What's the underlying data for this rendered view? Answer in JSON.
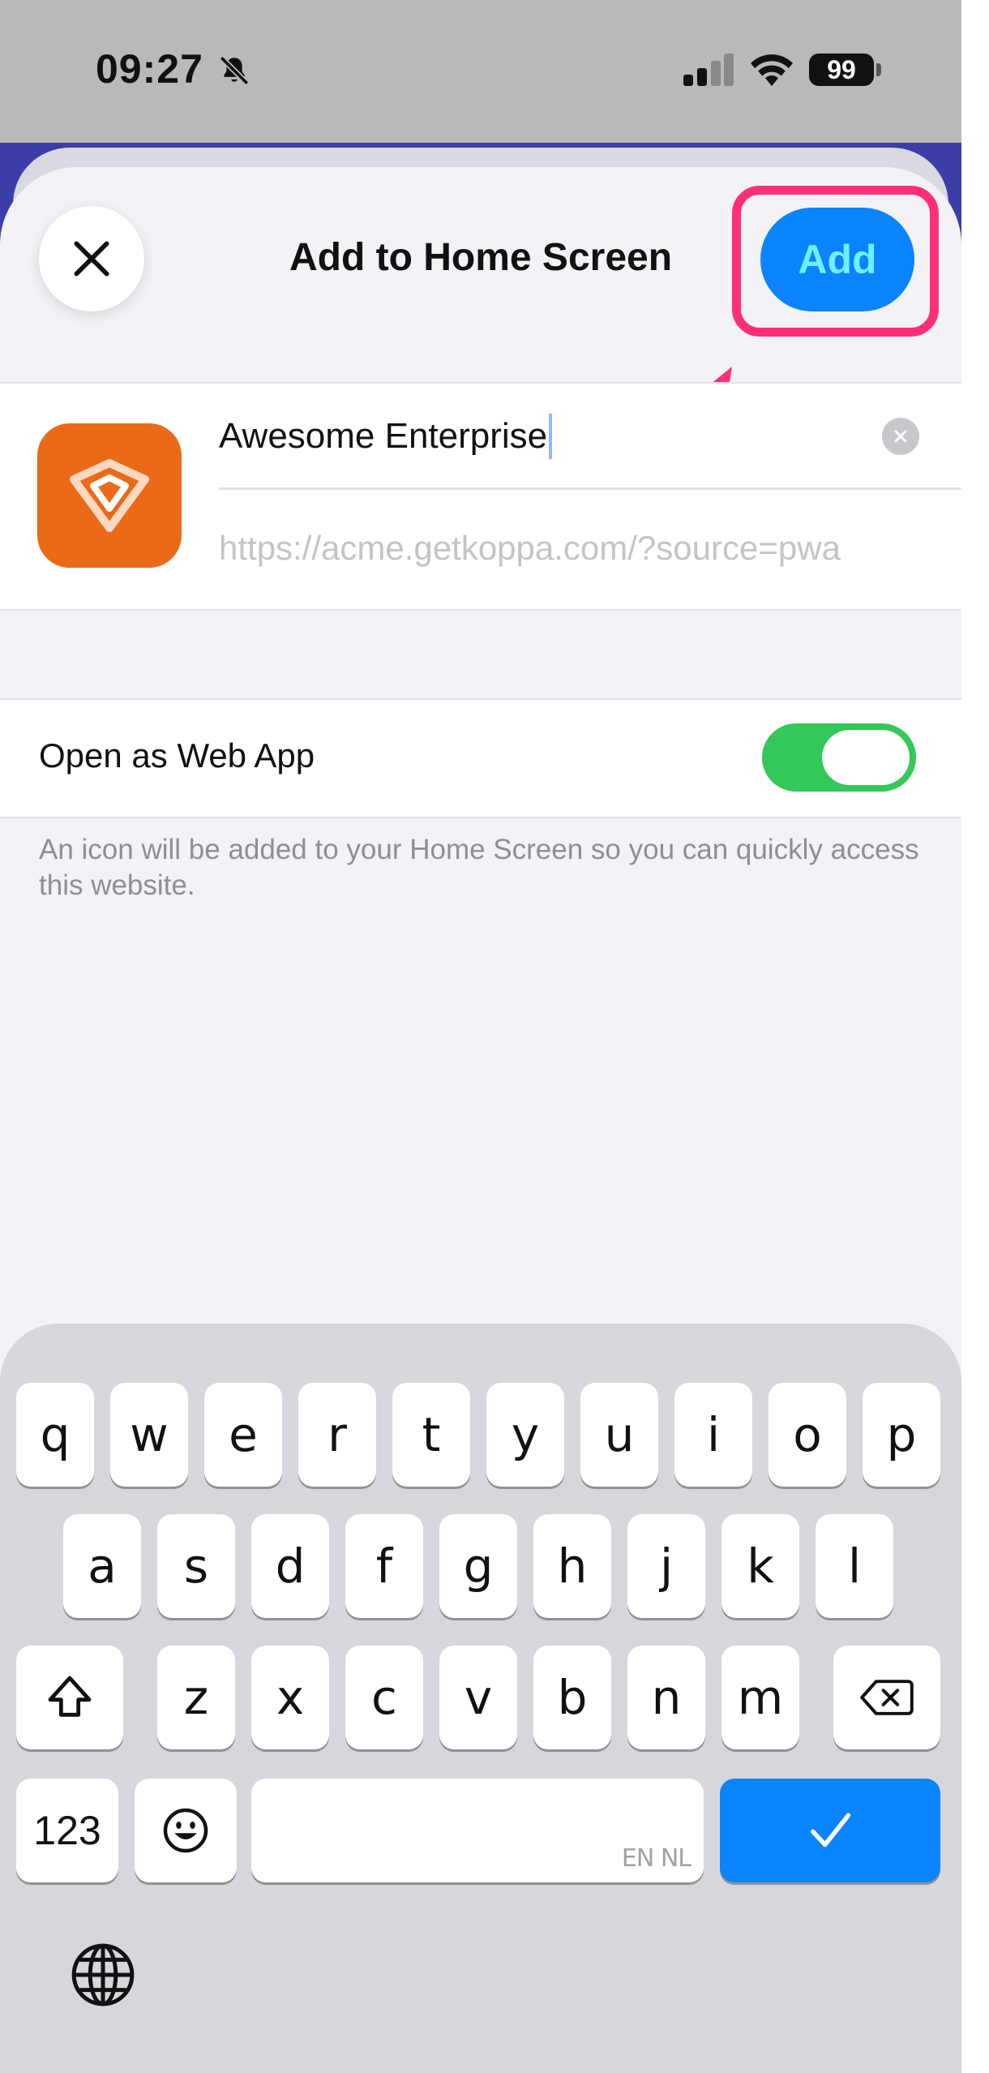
{
  "status_bar": {
    "time": "09:27",
    "battery": "99",
    "icons": [
      "bell-slash-icon",
      "cellular-signal-icon",
      "wifi-icon",
      "battery-icon"
    ]
  },
  "header": {
    "title": "Add to Home Screen",
    "close_icon": "close-icon",
    "add_label": "Add"
  },
  "bookmark": {
    "name_value": "Awesome Enterprise",
    "url": "https://acme.getkoppa.com/?source=pwa",
    "clear_icon": "clear-circle-icon",
    "app_icon": "koppa-app-icon"
  },
  "web_app": {
    "label": "Open as Web App",
    "toggle_on": true,
    "description": "An icon will be added to your Home Screen so you can quickly access this website."
  },
  "keyboard": {
    "row1": [
      "q",
      "w",
      "e",
      "r",
      "t",
      "y",
      "u",
      "i",
      "o",
      "p"
    ],
    "row2": [
      "a",
      "s",
      "d",
      "f",
      "g",
      "h",
      "j",
      "k",
      "l"
    ],
    "row3": [
      "z",
      "x",
      "c",
      "v",
      "b",
      "n",
      "m"
    ],
    "numbers_label": "123",
    "space_languages": "EN NL",
    "shift_icon": "shift-icon",
    "delete_icon": "delete-icon",
    "emoji_icon": "emoji-icon",
    "done_icon": "checkmark-icon",
    "globe_icon": "globe-icon"
  },
  "colors": {
    "accent": "#0a84ff",
    "highlight": "#ff2f7a",
    "toggle": "#34c759",
    "app_icon_bg": "#ea6a1a"
  }
}
